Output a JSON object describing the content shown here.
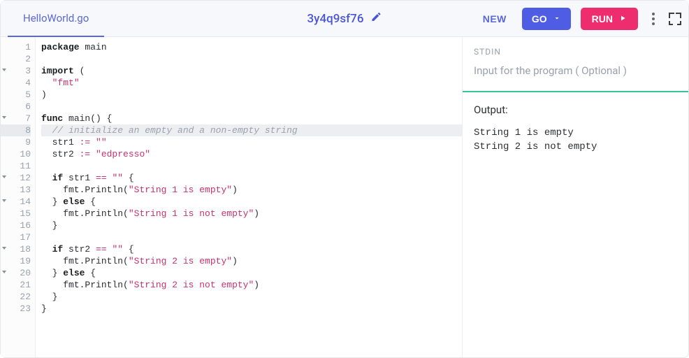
{
  "header": {
    "tab_name": "HelloWorld.go",
    "session_id": "3y4q9sf76",
    "new_label": "NEW",
    "lang_label": "GO",
    "run_label": "RUN"
  },
  "editor": {
    "filename": "HelloWorld.go",
    "language": "go",
    "highlighted_line": 8,
    "fold_lines": [
      3,
      7,
      12,
      14,
      18,
      20
    ],
    "lines": [
      {
        "n": 1,
        "tokens": [
          [
            "kw",
            "package"
          ],
          [
            "",
            " main"
          ]
        ]
      },
      {
        "n": 2,
        "tokens": []
      },
      {
        "n": 3,
        "tokens": [
          [
            "kw",
            "import"
          ],
          [
            "",
            " ("
          ]
        ]
      },
      {
        "n": 4,
        "tokens": [
          [
            "",
            "  "
          ],
          [
            "str",
            "\"fmt\""
          ]
        ]
      },
      {
        "n": 5,
        "tokens": [
          [
            "",
            ")"
          ]
        ]
      },
      {
        "n": 6,
        "tokens": []
      },
      {
        "n": 7,
        "tokens": [
          [
            "kw",
            "func"
          ],
          [
            "",
            " "
          ],
          [
            "fn",
            "main"
          ],
          [
            "",
            "() {"
          ]
        ]
      },
      {
        "n": 8,
        "tokens": [
          [
            "",
            "  "
          ],
          [
            "com",
            "// initialize an empty and a non-empty string"
          ]
        ]
      },
      {
        "n": 9,
        "tokens": [
          [
            "",
            "  str1 "
          ],
          [
            "op",
            ":="
          ],
          [
            "",
            " "
          ],
          [
            "str",
            "\"\""
          ]
        ]
      },
      {
        "n": 10,
        "tokens": [
          [
            "",
            "  str2 "
          ],
          [
            "op",
            ":="
          ],
          [
            "",
            " "
          ],
          [
            "str",
            "\"edpresso\""
          ]
        ]
      },
      {
        "n": 11,
        "tokens": []
      },
      {
        "n": 12,
        "tokens": [
          [
            "",
            "  "
          ],
          [
            "kw",
            "if"
          ],
          [
            "",
            " str1 "
          ],
          [
            "op",
            "=="
          ],
          [
            "",
            " "
          ],
          [
            "str",
            "\"\""
          ],
          [
            "",
            " {"
          ]
        ]
      },
      {
        "n": 13,
        "tokens": [
          [
            "",
            "    fmt."
          ],
          [
            "fn",
            "Println"
          ],
          [
            "",
            "("
          ],
          [
            "str",
            "\"String 1 is empty\""
          ],
          [
            "",
            ")"
          ]
        ]
      },
      {
        "n": 14,
        "tokens": [
          [
            "",
            "  } "
          ],
          [
            "kw",
            "else"
          ],
          [
            "",
            " {"
          ]
        ]
      },
      {
        "n": 15,
        "tokens": [
          [
            "",
            "    fmt."
          ],
          [
            "fn",
            "Println"
          ],
          [
            "",
            "("
          ],
          [
            "str",
            "\"String 1 is not empty\""
          ],
          [
            "",
            ")"
          ]
        ]
      },
      {
        "n": 16,
        "tokens": [
          [
            "",
            "  }"
          ]
        ]
      },
      {
        "n": 17,
        "tokens": []
      },
      {
        "n": 18,
        "tokens": [
          [
            "",
            "  "
          ],
          [
            "kw",
            "if"
          ],
          [
            "",
            " str2 "
          ],
          [
            "op",
            "=="
          ],
          [
            "",
            " "
          ],
          [
            "str",
            "\"\""
          ],
          [
            "",
            " {"
          ]
        ]
      },
      {
        "n": 19,
        "tokens": [
          [
            "",
            "    fmt."
          ],
          [
            "fn",
            "Println"
          ],
          [
            "",
            "("
          ],
          [
            "str",
            "\"String 2 is empty\""
          ],
          [
            "",
            ")"
          ]
        ]
      },
      {
        "n": 20,
        "tokens": [
          [
            "",
            "  } "
          ],
          [
            "kw",
            "else"
          ],
          [
            "",
            " {"
          ]
        ]
      },
      {
        "n": 21,
        "tokens": [
          [
            "",
            "    fmt."
          ],
          [
            "fn",
            "Println"
          ],
          [
            "",
            "("
          ],
          [
            "str",
            "\"String 2 is not empty\""
          ],
          [
            "",
            ")"
          ]
        ]
      },
      {
        "n": 22,
        "tokens": [
          [
            "",
            "  }"
          ]
        ]
      },
      {
        "n": 23,
        "tokens": [
          [
            "",
            "}"
          ]
        ]
      }
    ]
  },
  "stdin": {
    "label": "STDIN",
    "placeholder": "Input for the program ( Optional )",
    "value": ""
  },
  "output": {
    "label": "Output:",
    "text": "String 1 is empty\nString 2 is not empty"
  }
}
